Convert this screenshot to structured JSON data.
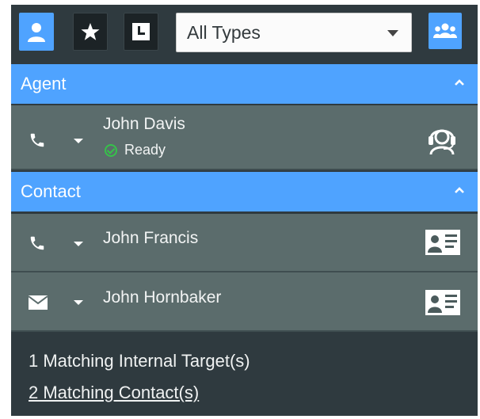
{
  "toolbar": {
    "type_filter": {
      "selected": "All Types"
    },
    "buttons": [
      {
        "icon": "person-icon",
        "state": "active"
      },
      {
        "icon": "star-icon",
        "state": "inactive"
      },
      {
        "icon": "clock-icon",
        "state": "inactive"
      },
      {
        "icon": "group-icon",
        "state": "active"
      }
    ]
  },
  "sections": {
    "agent": {
      "title": "Agent"
    },
    "contact": {
      "title": "Contact"
    }
  },
  "agents": [
    {
      "name": "John Davis",
      "status": "Ready",
      "status_color": "#36c24a",
      "channel_icon": "phone-icon",
      "type_icon": "headset-agent-icon"
    }
  ],
  "contacts": [
    {
      "name": "John Francis",
      "channel_icon": "phone-icon",
      "type_icon": "contact-card-icon"
    },
    {
      "name": "John Hornbaker",
      "channel_icon": "envelope-icon",
      "type_icon": "contact-card-icon"
    }
  ],
  "footer": {
    "internal_targets": "1 Matching Internal Target(s)",
    "contacts_link": "2 Matching Contact(s)"
  },
  "colors": {
    "accent": "#4fa3ff",
    "panel_bg": "#2f3a3f",
    "row_bg": "#5b6c6c"
  }
}
